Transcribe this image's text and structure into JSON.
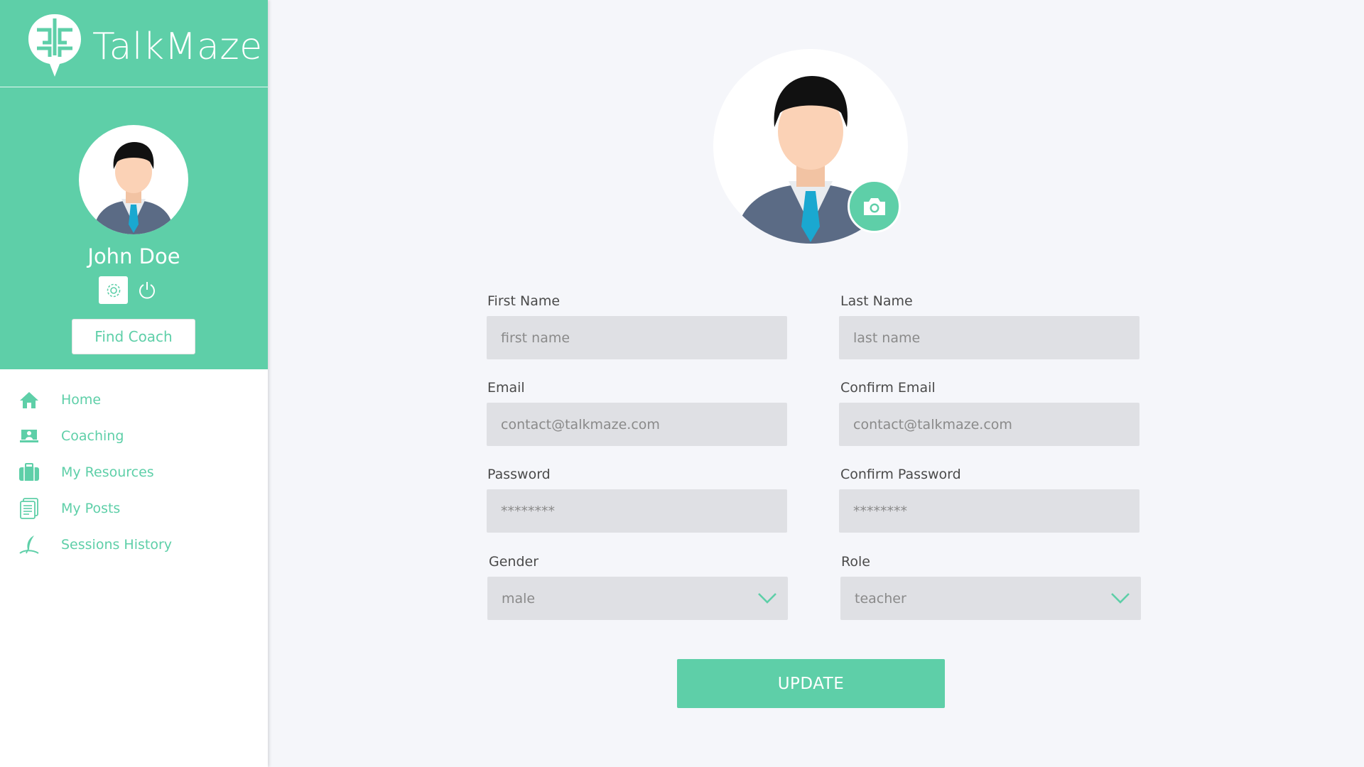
{
  "app": {
    "brand": "TalkMaze"
  },
  "sidebar": {
    "user_name": "John Doe",
    "find_coach_label": "Find Coach",
    "nav": [
      {
        "label": "Home",
        "icon": "home-icon"
      },
      {
        "label": "Coaching",
        "icon": "coaching-icon"
      },
      {
        "label": "My Resources",
        "icon": "briefcase-icon"
      },
      {
        "label": "My Posts",
        "icon": "posts-icon"
      },
      {
        "label": "Sessions History",
        "icon": "quill-icon"
      }
    ]
  },
  "form": {
    "first_name": {
      "label": "First Name",
      "placeholder": "first name"
    },
    "last_name": {
      "label": "Last Name",
      "placeholder": "last name"
    },
    "email": {
      "label": "Email",
      "placeholder": "contact@talkmaze.com"
    },
    "confirm_email": {
      "label": "Confirm Email",
      "placeholder": "contact@talkmaze.com"
    },
    "password": {
      "label": "Password",
      "placeholder": "********"
    },
    "confirm_password": {
      "label": "Confirm Password",
      "placeholder": "********"
    },
    "gender": {
      "label": "Gender",
      "value": "male"
    },
    "role": {
      "label": "Role",
      "value": "teacher"
    },
    "update_label": "UPDATE"
  },
  "colors": {
    "accent": "#5ecfa8",
    "field_bg": "#dfe0e4",
    "page_bg": "#f5f6fa"
  }
}
